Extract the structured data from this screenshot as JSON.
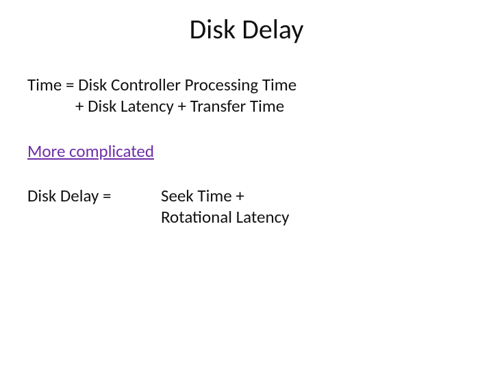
{
  "title": "Disk Delay",
  "formula": {
    "line1": "Time = Disk Controller Processing Time",
    "line2": "+ Disk Latency + Transfer Time"
  },
  "subheading": "More complicated",
  "delay": {
    "left": "Disk Delay =",
    "right_line1": "Seek Time +",
    "right_line2": "Rotational Latency"
  }
}
